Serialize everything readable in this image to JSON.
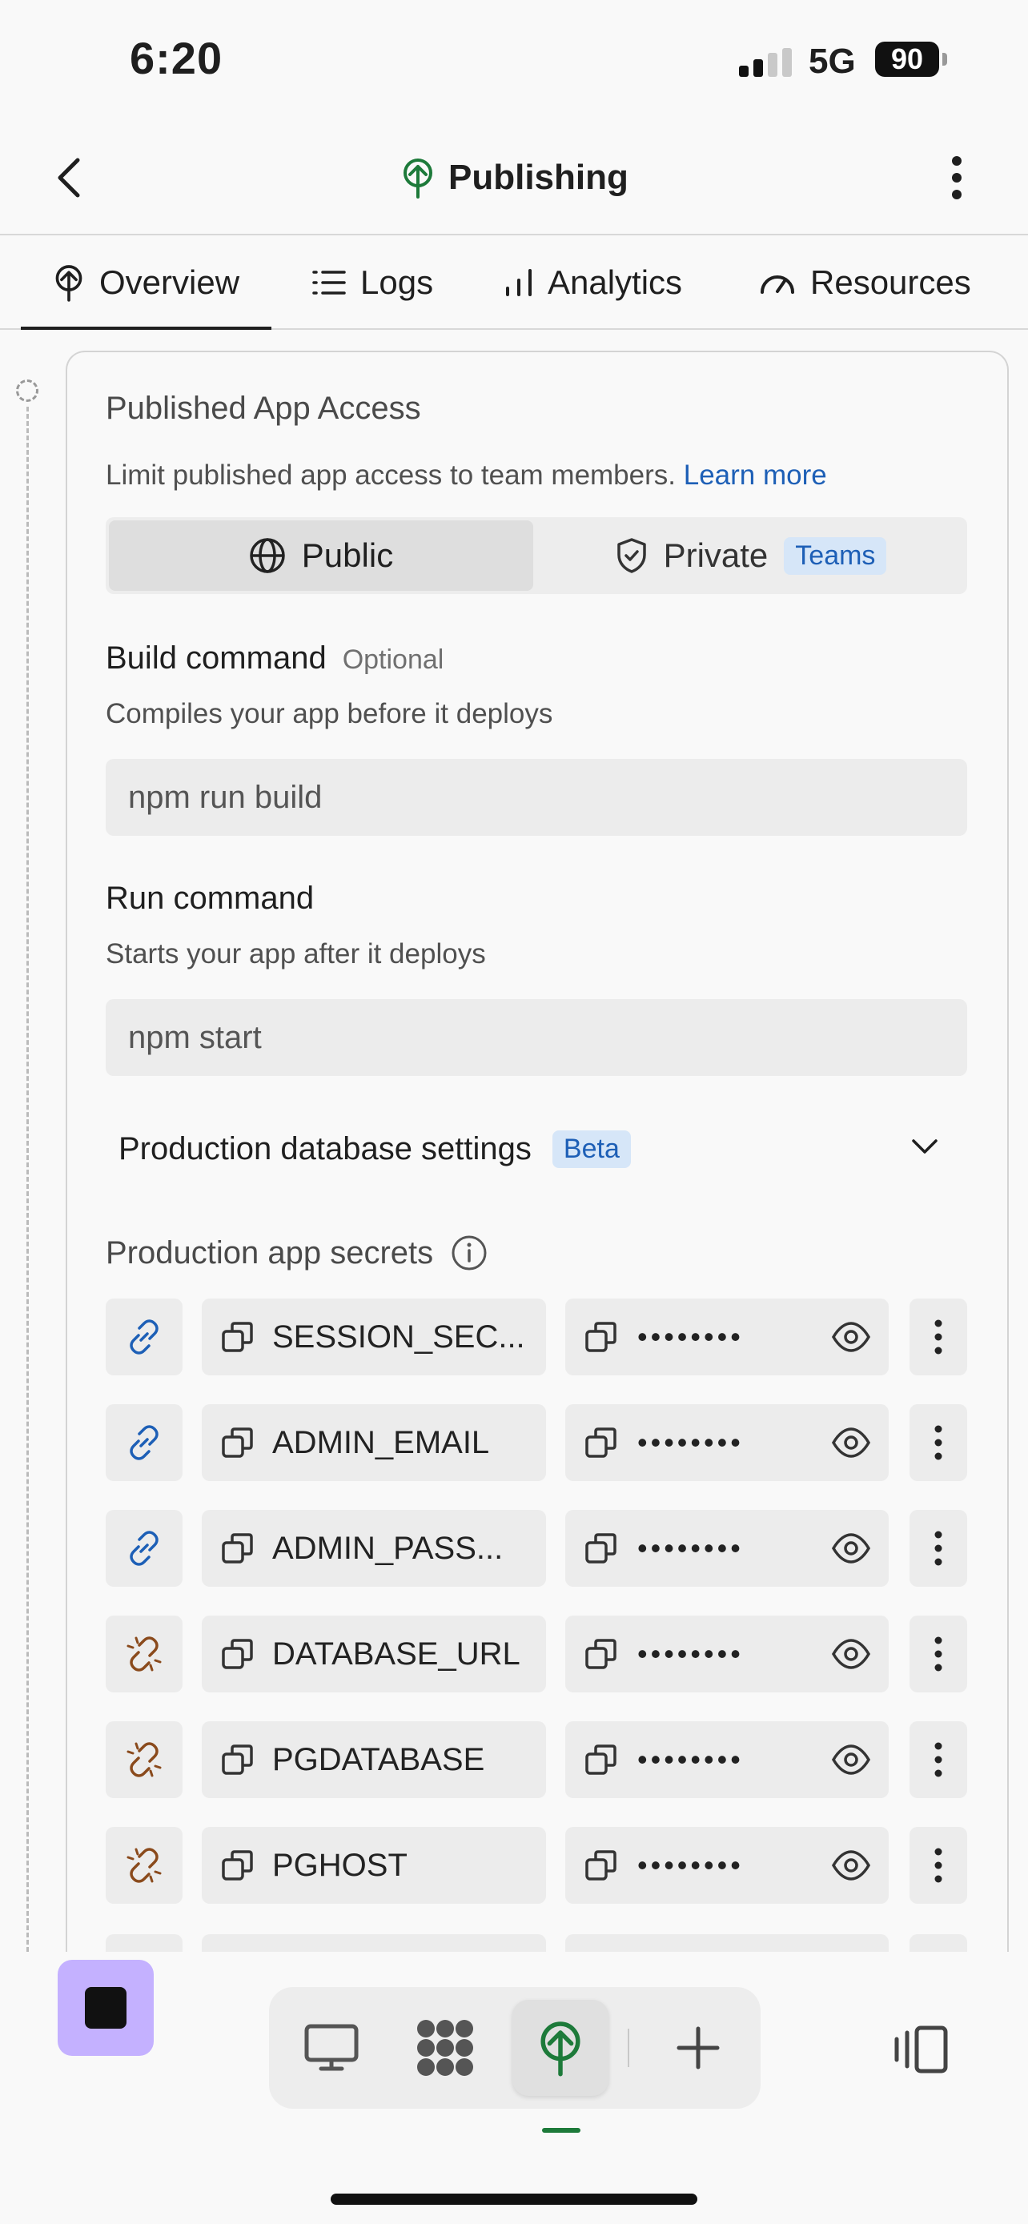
{
  "status_bar": {
    "time": "6:20",
    "network": "5G",
    "battery": "90"
  },
  "header": {
    "title": "Publishing"
  },
  "tabs": [
    {
      "label": "Overview",
      "icon": "publish-tree-icon"
    },
    {
      "label": "Logs",
      "icon": "list-icon"
    },
    {
      "label": "Analytics",
      "icon": "bar-chart-icon"
    },
    {
      "label": "Resources",
      "icon": "gauge-icon"
    }
  ],
  "access": {
    "title": "Published App Access",
    "helper": "Limit published app access to team members.",
    "learn_more": "Learn more",
    "public_label": "Public",
    "private_label": "Private",
    "teams_badge": "Teams"
  },
  "build": {
    "label": "Build command",
    "optional": "Optional",
    "helper": "Compiles your app before it deploys",
    "value": "npm run build"
  },
  "run": {
    "label": "Run command",
    "helper": "Starts your app after it deploys",
    "value": "npm start"
  },
  "database": {
    "label": "Production database settings",
    "badge": "Beta"
  },
  "secrets": {
    "title": "Production app secrets",
    "masked": "••••••••",
    "rows": [
      {
        "key": "SESSION_SEC...",
        "link_state": "linked"
      },
      {
        "key": "ADMIN_EMAIL",
        "link_state": "linked"
      },
      {
        "key": "ADMIN_PASS...",
        "link_state": "linked"
      },
      {
        "key": "DATABASE_URL",
        "link_state": "unlinked"
      },
      {
        "key": "PGDATABASE",
        "link_state": "unlinked"
      },
      {
        "key": "PGHOST",
        "link_state": "unlinked"
      }
    ]
  },
  "colors": {
    "accent_green": "#1d7a3a",
    "link_blue": "#1d5fb6",
    "unlinked_brown": "#8a4a1c",
    "stop_purple": "#c4b1ff"
  }
}
